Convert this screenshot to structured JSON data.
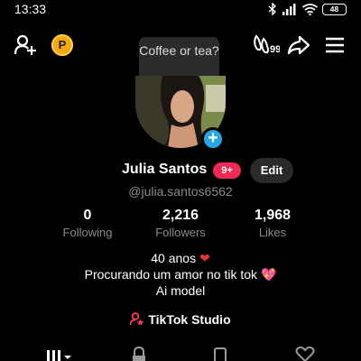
{
  "status_bar": {
    "time": "13:33",
    "battery": "48"
  },
  "header": {
    "coin_letter": "P",
    "tooltip_text": "Coffee or tea?"
  },
  "profile": {
    "name": "Julia Santos",
    "notification_count": "9+",
    "edit_label": "Edit",
    "username": "@julia.santos6562"
  },
  "stats": [
    {
      "value": "0",
      "label": "Following"
    },
    {
      "value": "2,216",
      "label": "Followers"
    },
    {
      "value": "1,968",
      "label": "Likes"
    }
  ],
  "bio": {
    "line1": "40 anos",
    "line2": "Procurando um amor no tik tok",
    "line3": "Ai model"
  },
  "studio": {
    "label": "TikTok Studio"
  },
  "colors": {
    "accent_blue": "#22a9e6",
    "badge_red": "#f02a57",
    "coin_orange": "#f6a812"
  },
  "icons": {
    "header_left": [
      "add-friend-icon",
      "coin-icon"
    ],
    "header_right": [
      "footprint-icon",
      "share-icon",
      "menu-icon"
    ],
    "tabs": [
      "grid-icon",
      "lock-icon",
      "repost-icon",
      "heart-icon"
    ]
  }
}
